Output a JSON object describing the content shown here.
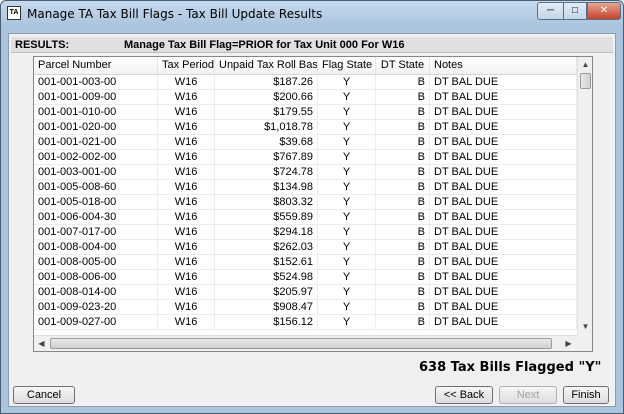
{
  "window": {
    "icon_label": "TA",
    "title": "Manage TA Tax Bill Flags - Tax Bill Update Results"
  },
  "results": {
    "label": "RESULTS:",
    "message": "Manage Tax Bill Flag=PRIOR for Tax Unit 000 For  W16"
  },
  "columns": [
    "Parcel Number",
    "Tax Period",
    "Unpaid Tax Roll Base",
    "Flag State",
    "DT State",
    "Notes"
  ],
  "rows": [
    [
      "001-001-003-00",
      "W16",
      "$187.26",
      "Y",
      "B",
      "DT BAL DUE"
    ],
    [
      "001-001-009-00",
      "W16",
      "$200.66",
      "Y",
      "B",
      "DT BAL DUE"
    ],
    [
      "001-001-010-00",
      "W16",
      "$179.55",
      "Y",
      "B",
      "DT BAL DUE"
    ],
    [
      "001-001-020-00",
      "W16",
      "$1,018.78",
      "Y",
      "B",
      "DT BAL DUE"
    ],
    [
      "001-001-021-00",
      "W16",
      "$39.68",
      "Y",
      "B",
      "DT BAL DUE"
    ],
    [
      "001-002-002-00",
      "W16",
      "$767.89",
      "Y",
      "B",
      "DT BAL DUE"
    ],
    [
      "001-003-001-00",
      "W16",
      "$724.78",
      "Y",
      "B",
      "DT BAL DUE"
    ],
    [
      "001-005-008-60",
      "W16",
      "$134.98",
      "Y",
      "B",
      "DT BAL DUE"
    ],
    [
      "001-005-018-00",
      "W16",
      "$803.32",
      "Y",
      "B",
      "DT BAL DUE"
    ],
    [
      "001-006-004-30",
      "W16",
      "$559.89",
      "Y",
      "B",
      "DT BAL DUE"
    ],
    [
      "001-007-017-00",
      "W16",
      "$294.18",
      "Y",
      "B",
      "DT BAL DUE"
    ],
    [
      "001-008-004-00",
      "W16",
      "$262.03",
      "Y",
      "B",
      "DT BAL DUE"
    ],
    [
      "001-008-005-00",
      "W16",
      "$152.61",
      "Y",
      "B",
      "DT BAL DUE"
    ],
    [
      "001-008-006-00",
      "W16",
      "$524.98",
      "Y",
      "B",
      "DT BAL DUE"
    ],
    [
      "001-008-014-00",
      "W16",
      "$205.97",
      "Y",
      "B",
      "DT BAL DUE"
    ],
    [
      "001-009-023-20",
      "W16",
      "$908.47",
      "Y",
      "B",
      "DT BAL DUE"
    ],
    [
      "001-009-027-00",
      "W16",
      "$156.12",
      "Y",
      "B",
      "DT BAL DUE"
    ]
  ],
  "summary": "638 Tax Bills Flagged \"Y\"",
  "buttons": {
    "cancel": "Cancel",
    "back": "<< Back",
    "next": "Next",
    "finish": "Finish"
  },
  "icons": {
    "minimize": "minimize-icon",
    "maximize": "maximize-icon",
    "close": "close-icon",
    "scroll_up": "arrow-up-icon",
    "scroll_down": "arrow-down-icon",
    "scroll_left": "arrow-left-icon",
    "scroll_right": "arrow-right-icon"
  }
}
